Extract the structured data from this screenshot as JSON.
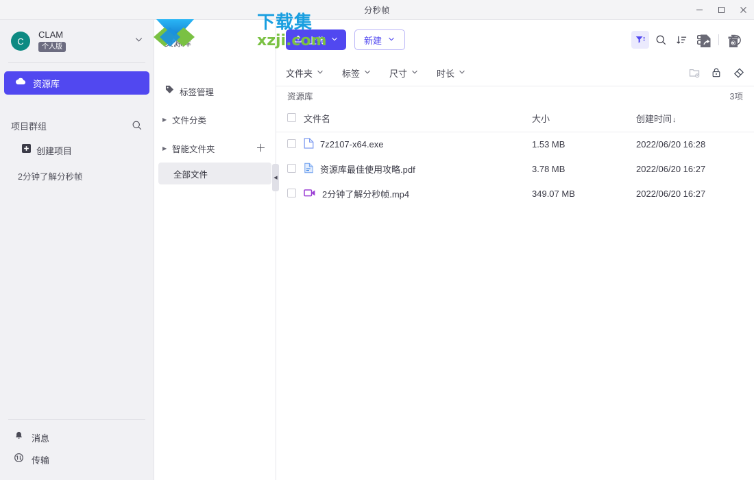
{
  "window": {
    "title": "分秒帧",
    "minimize_label": "minimize",
    "maximize_label": "maximize",
    "close_label": "close"
  },
  "watermark": {
    "cn_text": "下载集",
    "url_text": "xzji.com"
  },
  "sidebar": {
    "user": {
      "avatar_letter": "C",
      "name": "CLAM",
      "badge": "个人版",
      "caret_icon": "chevron-down-icon",
      "avatar_color": "#0d8a82"
    },
    "nav": [
      {
        "label": "资源库",
        "icon": "cloud-icon",
        "active": true
      }
    ],
    "group": {
      "title": "项目群组",
      "search_icon": "search-icon",
      "create_label": "创建项目",
      "create_icon": "plus-square-icon"
    },
    "projects": [
      {
        "label": "2分钟了解分秒帧"
      }
    ],
    "bottom": [
      {
        "label": "消息",
        "icon": "bell-icon"
      },
      {
        "label": "传输",
        "icon": "transfer-icon"
      }
    ],
    "accent": "#5148f0"
  },
  "panel2": {
    "header": {
      "label": "标签管理",
      "icon": "tag-icon"
    },
    "rows": [
      {
        "label": "文件分类",
        "has_plus": false
      },
      {
        "label": "智能文件夹",
        "has_plus": true
      }
    ],
    "selected": {
      "label": "全部文件"
    },
    "collapse_icon": "collapse-left-icon",
    "breadcrumb": "资源库"
  },
  "toolbar": {
    "upload_label": "上传",
    "upload_icon": "upload-icon",
    "new_label": "新建",
    "caret_icon": "chevron-down-icon",
    "icons": [
      {
        "name": "filter-icon",
        "active": true
      },
      {
        "name": "search-icon",
        "active": false
      },
      {
        "name": "sort-desc-icon",
        "active": false
      },
      {
        "name": "grid-view-icon",
        "active": false
      },
      {
        "name": "info-icon",
        "active": false
      }
    ]
  },
  "filterbar": {
    "filters": [
      {
        "label": "文件夹"
      },
      {
        "label": "标签"
      },
      {
        "label": "尺寸"
      },
      {
        "label": "时长"
      }
    ],
    "right_icons": [
      {
        "name": "folder-settings-icon",
        "dim": true
      },
      {
        "name": "lock-icon",
        "dim": false
      },
      {
        "name": "eraser-icon",
        "dim": false
      }
    ]
  },
  "list": {
    "title": "资源库",
    "count": "3项",
    "columns": {
      "name": "文件名",
      "size": "大小",
      "date": "创建时间",
      "sort_arrow": "↓"
    },
    "rows": [
      {
        "name": "7z2107-x64.exe",
        "size": "1.53 MB",
        "date": "2022/06/20 16:28",
        "icon": "file-generic-icon"
      },
      {
        "name": "资源库最佳使用攻略.pdf",
        "size": "3.78 MB",
        "date": "2022/06/20 16:27",
        "icon": "file-pdf-icon"
      },
      {
        "name": "2分钟了解分秒帧.mp4",
        "size": "349.07 MB",
        "date": "2022/06/20 16:27",
        "icon": "file-video-icon"
      }
    ]
  },
  "header_actions": [
    {
      "name": "share-file-icon"
    },
    {
      "name": "recycle-bin-icon"
    }
  ]
}
